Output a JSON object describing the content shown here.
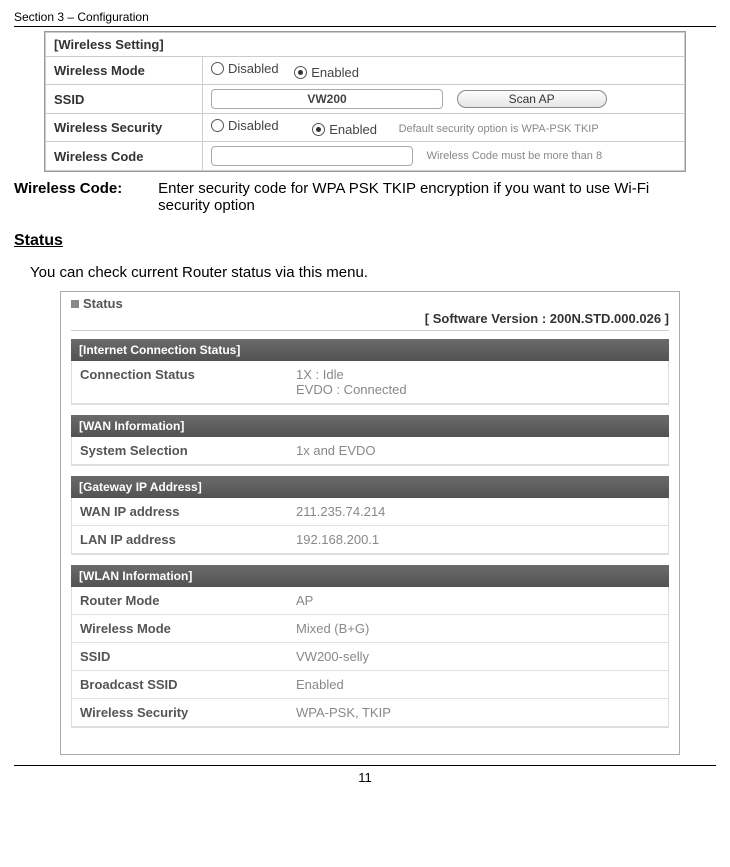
{
  "page": {
    "header": "Section 3 – Configuration",
    "page_number": "11"
  },
  "wireless_setting": {
    "title": "[Wireless Setting]",
    "rows": {
      "mode_label": "Wireless Mode",
      "mode_disabled": "Disabled",
      "mode_enabled": "Enabled",
      "ssid_label": "SSID",
      "ssid_value": "VW200",
      "scan_btn": "Scan AP",
      "security_label": "Wireless Security",
      "security_disabled": "Disabled",
      "security_enabled": "Enabled",
      "security_hint": "Default security option is WPA-PSK TKIP",
      "code_label": "Wireless Code",
      "code_hint": "Wireless Code must be more than 8"
    }
  },
  "wireless_code_desc": {
    "label": "Wireless Code:",
    "text": "Enter security code for WPA PSK TKIP encryption if you want to use Wi-Fi security option"
  },
  "status": {
    "heading": "Status",
    "intro": "You can check current Router status via this menu.",
    "panel_title": "Status",
    "version": "[ Software Version : 200N.STD.000.026 ]",
    "groups": [
      {
        "title": "[Internet Connection Status]",
        "rows": [
          {
            "k": "Connection Status",
            "v": "1X : Idle\nEVDO : Connected"
          }
        ]
      },
      {
        "title": "[WAN Information]",
        "rows": [
          {
            "k": "System Selection",
            "v": "1x and EVDO"
          }
        ]
      },
      {
        "title": "[Gateway IP Address]",
        "rows": [
          {
            "k": "WAN IP address",
            "v": "211.235.74.214"
          },
          {
            "k": "LAN IP address",
            "v": "192.168.200.1"
          }
        ]
      },
      {
        "title": "[WLAN Information]",
        "rows": [
          {
            "k": "Router Mode",
            "v": "AP"
          },
          {
            "k": "Wireless Mode",
            "v": "Mixed (B+G)"
          },
          {
            "k": "SSID",
            "v": "VW200-selly"
          },
          {
            "k": "Broadcast SSID",
            "v": "Enabled"
          },
          {
            "k": "Wireless Security",
            "v": "WPA-PSK, TKIP"
          }
        ]
      }
    ]
  }
}
